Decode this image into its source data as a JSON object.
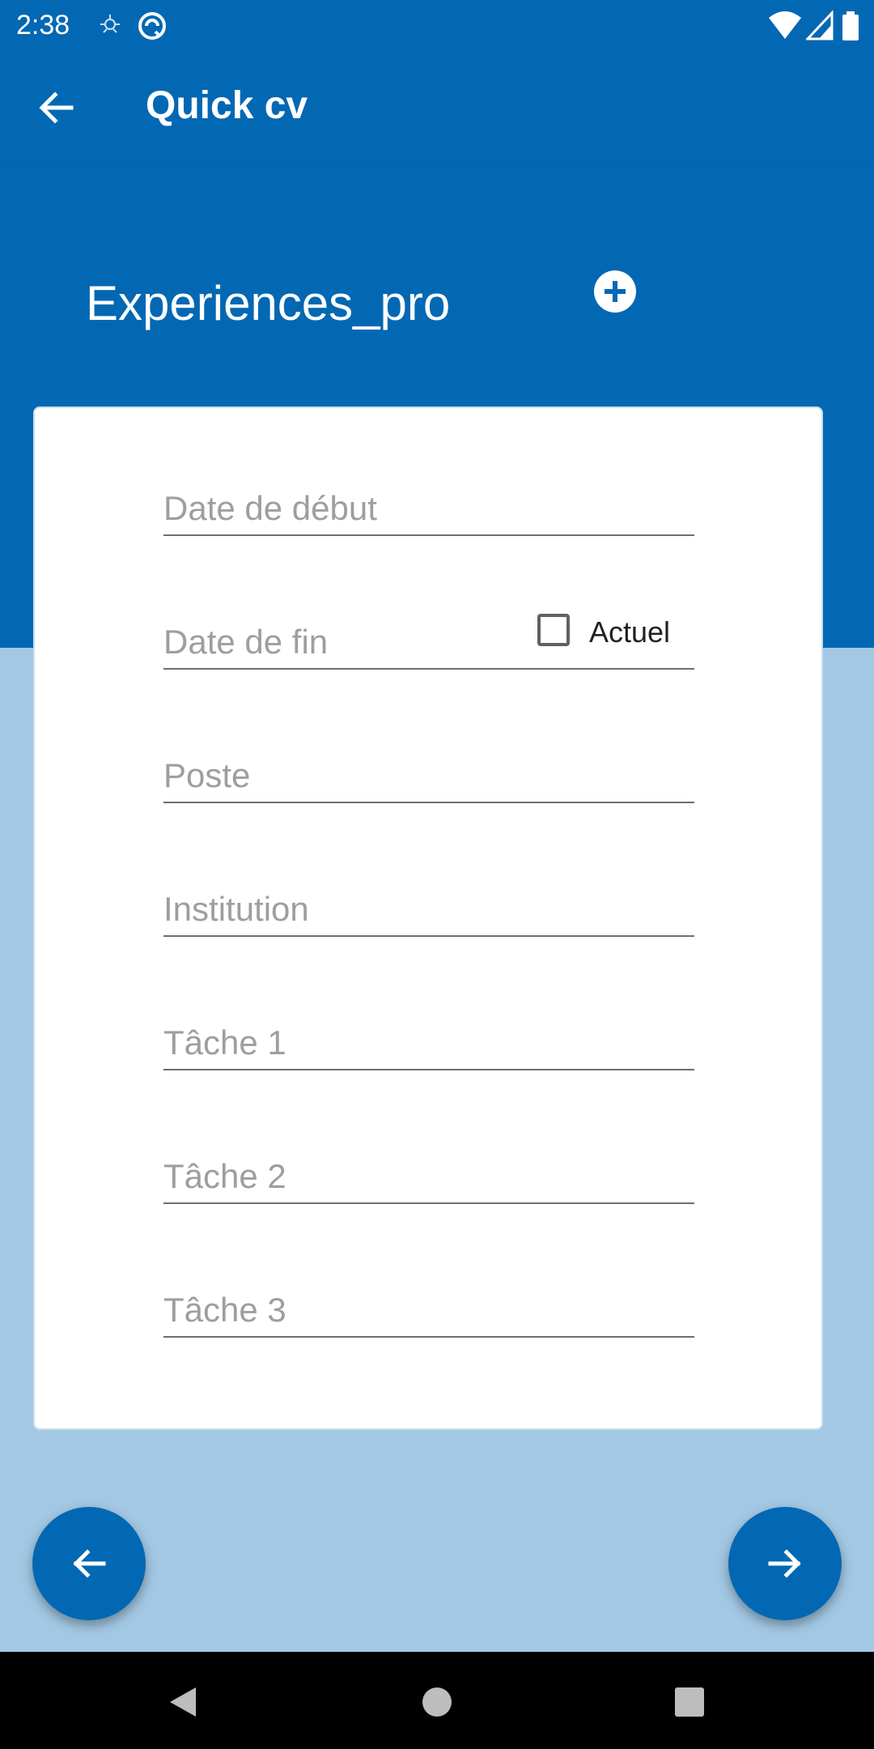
{
  "status_bar": {
    "time": "2:38",
    "icons": [
      "notification-icon",
      "sync-icon",
      "wifi-icon",
      "signal-icon",
      "battery-icon"
    ]
  },
  "app_bar": {
    "title": "Quick cv",
    "back_icon": "arrow-back-icon"
  },
  "section": {
    "title": "Experiences_pro",
    "add_icon": "add-circle-icon"
  },
  "form": {
    "fields": [
      {
        "placeholder": "Date de début",
        "value": ""
      },
      {
        "placeholder": "Date de fin",
        "value": ""
      },
      {
        "placeholder": "Poste",
        "value": ""
      },
      {
        "placeholder": "Institution",
        "value": ""
      },
      {
        "placeholder": "Tâche 1",
        "value": ""
      },
      {
        "placeholder": "Tâche 2",
        "value": ""
      },
      {
        "placeholder": "Tâche 3",
        "value": ""
      }
    ],
    "current_checkbox": {
      "label": "Actuel",
      "checked": false
    }
  },
  "navigation": {
    "previous_icon": "arrow-left-icon",
    "next_icon": "arrow-right-icon"
  },
  "system_nav": {
    "icons": [
      "back-triangle-icon",
      "home-circle-icon",
      "recents-square-icon"
    ]
  },
  "colors": {
    "primary": "#0368b3",
    "background_light": "#a3c8e4",
    "card": "#ffffff",
    "hint_text": "#9e9e9e"
  }
}
